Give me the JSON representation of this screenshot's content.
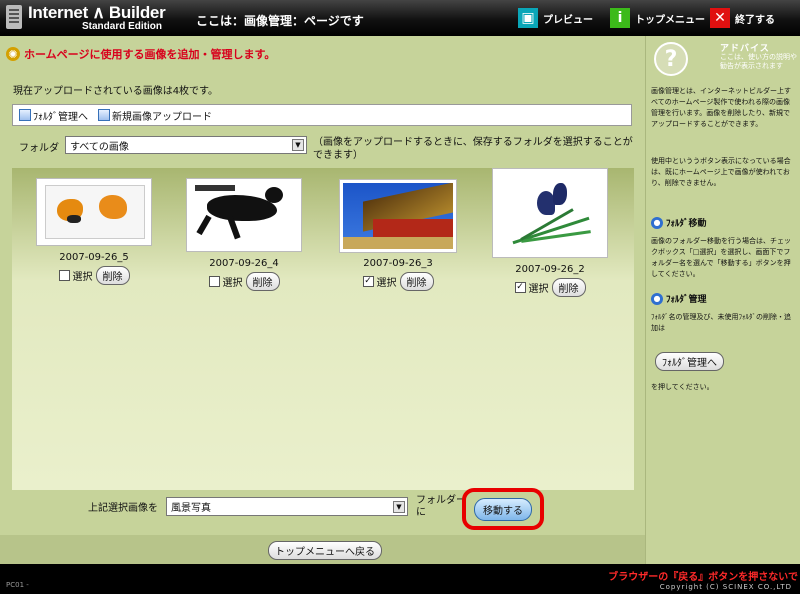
{
  "header": {
    "logo_line1": "Internet ∧ Builder",
    "logo_line2": "Standard Edition",
    "page_title": "ここは：画像管理：ページです",
    "preview_label": "プレビュー",
    "top_menu_label": "トップメニュー",
    "exit_label": "終了する"
  },
  "main": {
    "heading": "ホームページに使用する画像を追加・管理します。",
    "count_text": "現在アップロードされている画像は4枚です。",
    "toolbar": {
      "folder_manage": "ﾌｫﾙﾀﾞ管理へ",
      "new_upload": "新規画像アップロード"
    },
    "folder_label": "フォルダ",
    "folder_selected": "すべての画像",
    "folder_note": "（画像をアップロードするときに、保存するフォルダを選択することができます）",
    "images": [
      {
        "name": "2007-09-26_5",
        "checked": false,
        "check_mark": "",
        "select_label": "選択",
        "delete_label": "削除"
      },
      {
        "name": "2007-09-26_4",
        "checked": false,
        "check_mark": "",
        "select_label": "選択",
        "delete_label": "削除"
      },
      {
        "name": "2007-09-26_3",
        "checked": true,
        "check_mark": "✓",
        "select_label": "選択",
        "delete_label": "削除"
      },
      {
        "name": "2007-09-26_2",
        "checked": true,
        "check_mark": "✓",
        "select_label": "選択",
        "delete_label": "削除"
      }
    ],
    "move_label": "上記選択画像を",
    "move_target": "風景写真",
    "folder_suffix_line1": "フォルダー",
    "folder_suffix_line2": "に",
    "move_button": "移動する",
    "back_button": "トップメニューへ戻る"
  },
  "sidebar": {
    "advice_title": "アドバイス",
    "advice_sub": "ここは、使い方の説明や勧告が表示されます",
    "intro": "画像管理とは、インターネットビルダー上すべてのホームページ製作で使われる際の画像管理を行います。画像を削除したり、新規でアップロードすることができます。",
    "note": "使用中といううボタン表示になっている場合は、既にホームページ上で画像が使われており、削除できません。",
    "move_heading": "ﾌｫﾙﾀﾞ移動",
    "move_text": "画像のフォルダー移動を行う場合は、チェックボックス「□選択」を選択し、画面下でフォルダー名を選んで「移動する」ボタンを押してください。",
    "manage_heading": "ﾌｫﾙﾀﾞ管理",
    "manage_text": "ﾌｫﾙﾀﾞ名の管理及び、未使用ﾌｫﾙﾀﾞの削除・追加は",
    "manage_button": "ﾌｫﾙﾀﾞ管理へ",
    "manage_after": "を押してください。"
  },
  "statusbar": {
    "left": "PC01 -",
    "warning": "ブラウザーの『戻る』ボタンを押さないで",
    "copyright": "Copyright (C) SCINEX CO.,LTD"
  },
  "colors": {
    "background": "#c6d39a",
    "accent_red": "#d8001c",
    "highlight": "#e80000"
  }
}
